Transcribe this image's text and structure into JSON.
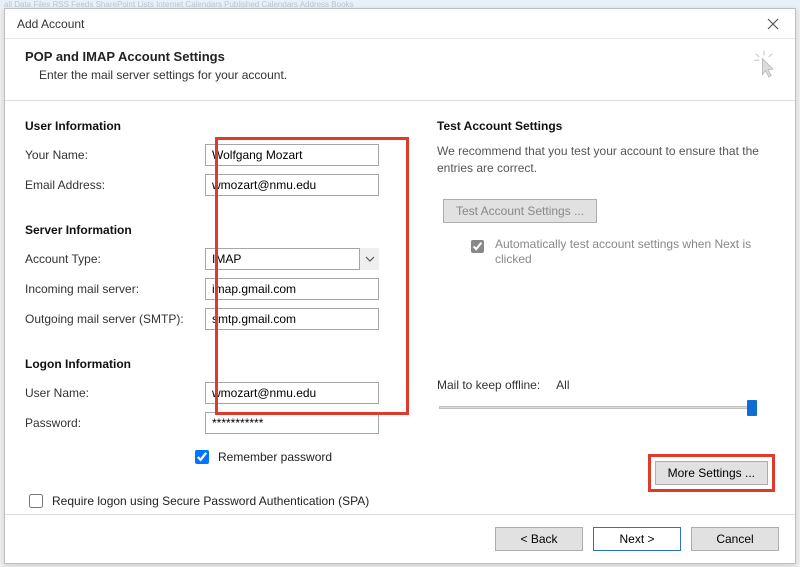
{
  "ghost_bar": "all   Data Files   RSS Feeds   SharePoint Lists   Internet Calendars   Published Calendars   Address Books",
  "titlebar": {
    "title": "Add Account"
  },
  "header": {
    "heading": "POP and IMAP Account Settings",
    "subheading": "Enter the mail server settings for your account."
  },
  "left": {
    "section_user": "User Information",
    "your_name_label": "Your Name:",
    "your_name_value": "Wolfgang Mozart",
    "email_label": "Email Address:",
    "email_value": "wmozart@nmu.edu",
    "section_server": "Server Information",
    "account_type_label": "Account Type:",
    "account_type_value": "IMAP",
    "incoming_label": "Incoming mail server:",
    "incoming_value": "imap.gmail.com",
    "outgoing_label": "Outgoing mail server (SMTP):",
    "outgoing_value": "smtp.gmail.com",
    "section_logon": "Logon Information",
    "username_label": "User Name:",
    "username_value": "wmozart@nmu.edu",
    "password_label": "Password:",
    "password_value": "***********",
    "remember_label": "Remember password",
    "remember_checked": true,
    "spa_label": "Require logon using Secure Password Authentication (SPA)",
    "spa_checked": false
  },
  "right": {
    "section_test": "Test Account Settings",
    "desc": "We recommend that you test your account to ensure that the entries are correct.",
    "test_button": "Test Account Settings ...",
    "auto_test_label": "Automatically test account settings when Next is clicked",
    "auto_test_checked": true,
    "mail_offline_label": "Mail to keep offline:",
    "mail_offline_value": "All",
    "more_settings_button": "More Settings ..."
  },
  "footer": {
    "back": "< Back",
    "next": "Next >",
    "cancel": "Cancel"
  }
}
